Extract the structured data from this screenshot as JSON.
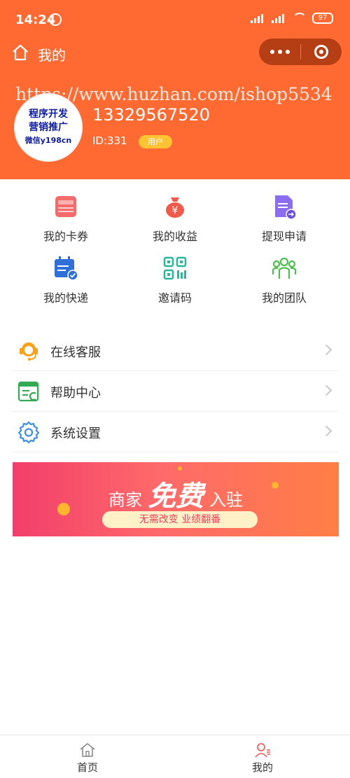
{
  "status_bar": {
    "time": "14:24",
    "battery": "97"
  },
  "nav": {
    "title": "我的"
  },
  "watermark": {
    "url": "https://www.huzhan.com/ishop5534"
  },
  "avatar": {
    "line1": "程序开发",
    "line2": "营销推广",
    "line3": "微信y198cn"
  },
  "profile": {
    "phone": "13329567520",
    "id": "ID:331",
    "role": "用户"
  },
  "grid": [
    {
      "label": "我的卡券",
      "icon": "card-coupon-icon"
    },
    {
      "label": "我的收益",
      "icon": "money-bag-icon"
    },
    {
      "label": "提现申请",
      "icon": "withdraw-document-icon"
    },
    {
      "label": "我的快递",
      "icon": "calendar-check-icon"
    },
    {
      "label": "邀请码",
      "icon": "qr-code-icon"
    },
    {
      "label": "我的团队",
      "icon": "team-icon"
    }
  ],
  "menu": [
    {
      "label": "在线客服",
      "icon": "headset-icon"
    },
    {
      "label": "帮助中心",
      "icon": "help-document-icon"
    },
    {
      "label": "系统设置",
      "icon": "gear-icon"
    }
  ],
  "banner": {
    "word1": "商家",
    "word2": "免费",
    "word3": "入驻",
    "slogan": "无需改变 业绩翻番"
  },
  "tabbar": [
    {
      "label": "首页",
      "icon": "home-icon"
    },
    {
      "label": "我的",
      "icon": "profile-icon"
    }
  ],
  "colors": {
    "brand": "#FF6A33",
    "badge": "#FFC233"
  }
}
